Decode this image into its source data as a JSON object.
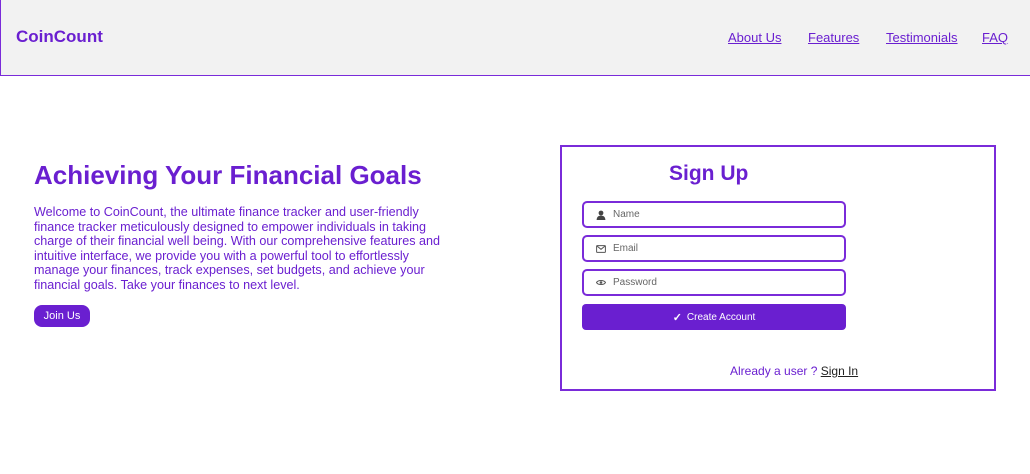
{
  "header": {
    "brand": "CoinCount",
    "nav": [
      "About Us",
      "Features",
      "Testimonials",
      "FAQ"
    ]
  },
  "hero": {
    "title": "Achieving Your Financial Goals",
    "text": "Welcome to CoinCount, the ultimate finance tracker and user-friendly finance tracker meticulously designed to empower individuals in taking charge of their financial well being. With our comprehensive features and intuitive interface, we provide you with a powerful tool to effortlessly manage your finances, track expenses, set budgets, and achieve your financial goals. Take your finances to next level.",
    "join_label": "Join Us"
  },
  "signup": {
    "title": "Sign Up",
    "name_placeholder": "Name",
    "email_placeholder": "Email",
    "password_placeholder": "Password",
    "create_label": "Create Account",
    "create_icon": "✓",
    "already_text": "Already a user ?",
    "signin_label": "Sign In"
  },
  "icons": {
    "name": "user-icon",
    "email": "mail-icon",
    "password": "eye-icon",
    "create": "check-icon"
  },
  "colors": {
    "accent": "#6a1fd0",
    "header_bg": "#f2f2f2"
  }
}
